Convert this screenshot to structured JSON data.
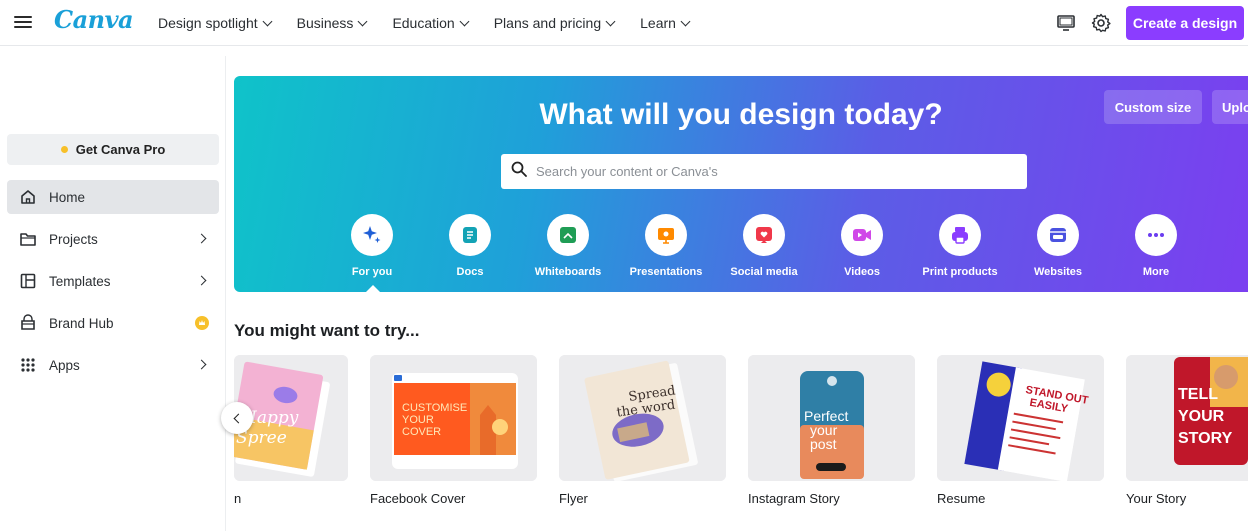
{
  "header": {
    "logo": "Canva",
    "nav": [
      {
        "label": "Design spotlight"
      },
      {
        "label": "Business"
      },
      {
        "label": "Education"
      },
      {
        "label": "Plans and pricing"
      },
      {
        "label": "Learn"
      }
    ],
    "create_button": "Create a design",
    "icons": [
      "menu-icon",
      "desktop-icon",
      "gear-icon"
    ]
  },
  "sidebar": {
    "pro_button": "Get Canva Pro",
    "items": [
      {
        "label": "Home",
        "icon": "home-icon",
        "active": true
      },
      {
        "label": "Projects",
        "icon": "folder-icon"
      },
      {
        "label": "Templates",
        "icon": "template-icon"
      },
      {
        "label": "Brand Hub",
        "icon": "brand-hub-icon"
      },
      {
        "label": "Apps",
        "icon": "apps-grid-icon"
      }
    ]
  },
  "hero": {
    "title": "What will you design today?",
    "custom_size": "Custom size",
    "upload": "Uplo",
    "search_placeholder": "Search your content or Canva's",
    "categories": [
      {
        "label": "For you",
        "icon": "sparkle-icon",
        "color": "#1f5fd6"
      },
      {
        "label": "Docs",
        "icon": "docs-icon",
        "color": "#13a3b5"
      },
      {
        "label": "Whiteboards",
        "icon": "whiteboard-icon",
        "color": "#1f9d55"
      },
      {
        "label": "Presentations",
        "icon": "presentation-icon",
        "color": "#ff8a00"
      },
      {
        "label": "Social media",
        "icon": "heart-icon",
        "color": "#f0384a"
      },
      {
        "label": "Videos",
        "icon": "video-icon",
        "color": "#d048e8"
      },
      {
        "label": "Print products",
        "icon": "print-icon",
        "color": "#8b3dff"
      },
      {
        "label": "Websites",
        "icon": "website-icon",
        "color": "#4a52e0"
      },
      {
        "label": "More",
        "icon": "more-icon",
        "color": "#6b3df0"
      }
    ]
  },
  "suggestions": {
    "title": "You might want to try...",
    "cards": [
      {
        "label": "n",
        "thumb_text": "Happy Spree"
      },
      {
        "label": "Facebook Cover",
        "thumb_text": "CUSTOMISE YOUR COVER"
      },
      {
        "label": "Flyer",
        "thumb_text": "Spread the word"
      },
      {
        "label": "Instagram Story",
        "thumb_text": "Perfect your post"
      },
      {
        "label": "Resume",
        "thumb_text": "STAND OUT EASILY"
      },
      {
        "label": "Your Story",
        "thumb_text": "TELL YOUR STORY"
      }
    ]
  }
}
